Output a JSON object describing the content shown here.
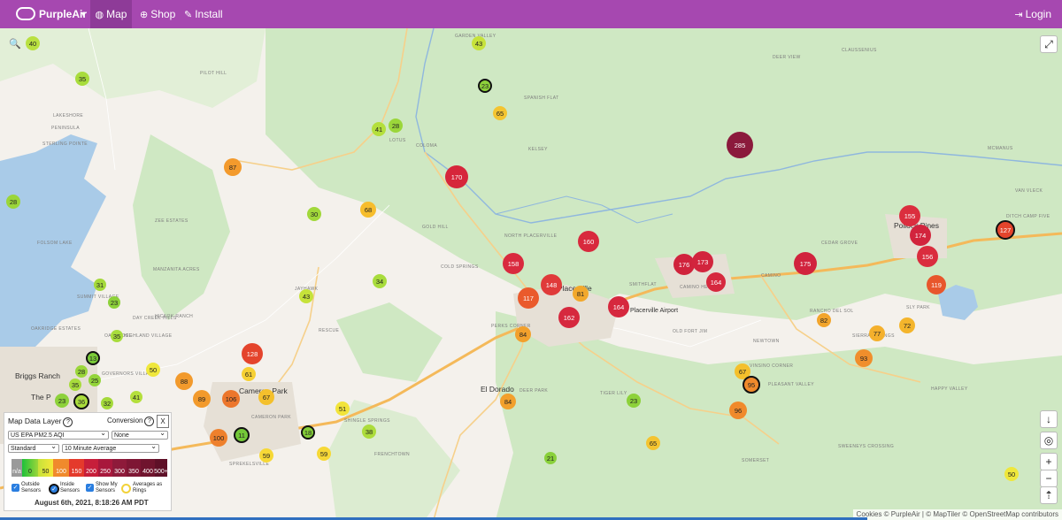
{
  "nav": {
    "brand": "PurpleAir",
    "map": "Map",
    "shop": "Shop",
    "install": "Install",
    "login": "Login"
  },
  "map_labels": [
    {
      "text": "GARDEN VALLEY"
    },
    {
      "text": "PILOT HILL"
    },
    {
      "text": "DEER VIEW"
    },
    {
      "text": "CLAUSSENIUS"
    },
    {
      "text": "SPANISH FLAT"
    },
    {
      "text": "LAKESHORE"
    },
    {
      "text": "PENINSULA"
    },
    {
      "text": "STERLING POINTE"
    },
    {
      "text": "LOTUS"
    },
    {
      "text": "COLOMA"
    },
    {
      "text": "KELSEY"
    },
    {
      "text": "MCMANUS"
    },
    {
      "text": "VAN VLECK"
    },
    {
      "text": "ZEE ESTATES"
    },
    {
      "text": "GOLD HILL"
    },
    {
      "text": "NORTH PLACERVILLE"
    },
    {
      "text": "DITCH CAMP FIVE"
    },
    {
      "text": "CEDAR GROVE"
    },
    {
      "text": "COLD SPRINGS"
    },
    {
      "text": "SMITHFLAT"
    },
    {
      "text": "CAMINO HEIGHTS"
    },
    {
      "text": "CAMINO"
    },
    {
      "text": "MANZANITA ACRES"
    },
    {
      "text": "SUMMIT VILLAGE"
    },
    {
      "text": "JAYHAWK"
    },
    {
      "text": "DAY CREEK HILLS"
    },
    {
      "text": "HICKOK RANCH"
    },
    {
      "text": "RANCHO DEL SOL"
    },
    {
      "text": "SLY PARK"
    },
    {
      "text": "OAK RIDGE"
    },
    {
      "text": "OAKRIDGE ESTATES"
    },
    {
      "text": "RESCUE"
    },
    {
      "text": "PERKS CORNER"
    },
    {
      "text": "OLD FORT JIM"
    },
    {
      "text": "NEWTOWN"
    },
    {
      "text": "SIERRA SPRINGS"
    },
    {
      "text": "GOVERNORS VILLAGE"
    },
    {
      "text": "VINSINO CORNER"
    },
    {
      "text": "DEER PARK"
    },
    {
      "text": "TIGER LILY"
    },
    {
      "text": "PLEASANT VALLEY"
    },
    {
      "text": "HAPPY VALLEY"
    },
    {
      "text": "CAMERON PARK"
    },
    {
      "text": "SHINGLE SPRINGS"
    },
    {
      "text": "SOMERSET"
    },
    {
      "text": "SWEENEYS CROSSING"
    },
    {
      "text": "FRENCHTOWN"
    },
    {
      "text": "SPREKELSVILLE"
    },
    {
      "text": "FOLSOM LAKE"
    },
    {
      "text": "HIGHLAND VILLAGE"
    }
  ],
  "towns": {
    "briggs": "Briggs Ranch",
    "cameron": "Cameron Park",
    "placerville": "Placerville",
    "eldorado": "El Dorado",
    "pollock": "Pollock Pines",
    "airport": "Placerville Airport",
    "thep": "The P"
  },
  "markers": [
    {
      "v": "40",
      "c": "#b9e040"
    },
    {
      "v": "35",
      "c": "#a8dc3c"
    },
    {
      "v": "43",
      "c": "#c6e23a"
    },
    {
      "v": "23",
      "c": "#8dd13a",
      "ring": true
    },
    {
      "v": "65",
      "c": "#f4c430"
    },
    {
      "v": "41",
      "c": "#b4df3c"
    },
    {
      "v": "28",
      "c": "#9bd63a"
    },
    {
      "v": "285",
      "c": "#8b1a3c"
    },
    {
      "v": "87",
      "c": "#f39a2c"
    },
    {
      "v": "170",
      "c": "#d6263b"
    },
    {
      "v": "28",
      "c": "#9bd63a"
    },
    {
      "v": "30",
      "c": "#a1d83a"
    },
    {
      "v": "68",
      "c": "#f6bd2c"
    },
    {
      "v": "155",
      "c": "#db2e3e"
    },
    {
      "v": "174",
      "c": "#d2243d"
    },
    {
      "v": "127",
      "c": "#e4442c",
      "ring": true
    },
    {
      "v": "156",
      "c": "#da2c3e"
    },
    {
      "v": "160",
      "c": "#d8293d"
    },
    {
      "v": "158",
      "c": "#d92a3e"
    },
    {
      "v": "176",
      "c": "#d0233c"
    },
    {
      "v": "173",
      "c": "#d2243d"
    },
    {
      "v": "175",
      "c": "#d1233d"
    },
    {
      "v": "164",
      "c": "#d6283e"
    },
    {
      "v": "31",
      "c": "#a4d93a"
    },
    {
      "v": "34",
      "c": "#a8dc3c"
    },
    {
      "v": "148",
      "c": "#e03a3a"
    },
    {
      "v": "117",
      "c": "#ea5a2c"
    },
    {
      "v": "81",
      "c": "#f2a82c"
    },
    {
      "v": "119",
      "c": "#e8562c"
    },
    {
      "v": "23",
      "c": "#8dd13a"
    },
    {
      "v": "43",
      "c": "#c6e23a"
    },
    {
      "v": "162",
      "c": "#d6283e"
    },
    {
      "v": "164",
      "c": "#d6283e"
    },
    {
      "v": "82",
      "c": "#f2a52c"
    },
    {
      "v": "72",
      "c": "#f4b52c"
    },
    {
      "v": "35",
      "c": "#a8dc3c"
    },
    {
      "v": "84",
      "c": "#f2a02c"
    },
    {
      "v": "77",
      "c": "#f4b02c"
    },
    {
      "v": "93",
      "c": "#f08e2c"
    },
    {
      "v": "13",
      "c": "#7acb38",
      "ring": true
    },
    {
      "v": "28",
      "c": "#9bd63a"
    },
    {
      "v": "50",
      "c": "#efe73c"
    },
    {
      "v": "128",
      "c": "#e4442c"
    },
    {
      "v": "25",
      "c": "#93d43a"
    },
    {
      "v": "35",
      "c": "#a8dc3c"
    },
    {
      "v": "88",
      "c": "#f29a2c"
    },
    {
      "v": "61",
      "c": "#f6d034"
    },
    {
      "v": "67",
      "c": "#f4c02c"
    },
    {
      "v": "95",
      "c": "#f08a2c",
      "ring": true
    },
    {
      "v": "41",
      "c": "#b4df3c"
    },
    {
      "v": "23",
      "c": "#8dd13a"
    },
    {
      "v": "36",
      "c": "#aadc3c",
      "ring": true
    },
    {
      "v": "32",
      "c": "#a4d93a"
    },
    {
      "v": "89",
      "c": "#f29a2c"
    },
    {
      "v": "106",
      "c": "#ec762c"
    },
    {
      "v": "67",
      "c": "#f4c02c"
    },
    {
      "v": "51",
      "c": "#f2e43a"
    },
    {
      "v": "84",
      "c": "#f2a02c"
    },
    {
      "v": "23",
      "c": "#8dd13a"
    },
    {
      "v": "96",
      "c": "#f08a2c"
    },
    {
      "v": "100",
      "c": "#ee802c"
    },
    {
      "v": "11",
      "c": "#74c838",
      "ring": true
    },
    {
      "v": "18",
      "c": "#84ce38",
      "ring": true
    },
    {
      "v": "38",
      "c": "#acdc3c"
    },
    {
      "v": "59",
      "c": "#f6d836"
    },
    {
      "v": "59",
      "c": "#f6d836"
    },
    {
      "v": "65",
      "c": "#f4c430"
    },
    {
      "v": "21",
      "c": "#89d03a"
    },
    {
      "v": "50",
      "c": "#efe73c"
    }
  ],
  "panel": {
    "title": "Map Data Layer",
    "conversion": "Conversion",
    "layer_select": "US EPA PM2.5 AQI",
    "conversion_select": "None",
    "mode_select": "Standard",
    "avg_select": "10 Minute Average",
    "legend": [
      {
        "label": "n/a",
        "c": "#9a9a9a"
      },
      {
        "label": "0",
        "c": "#1ec03a"
      },
      {
        "label": "50",
        "c": "#f6e83a"
      },
      {
        "label": "100",
        "c": "#f08a2c"
      },
      {
        "label": "150",
        "c": "#e43a2c"
      },
      {
        "label": "200",
        "c": "#c71e3a"
      },
      {
        "label": "250",
        "c": "#a8183c"
      },
      {
        "label": "300",
        "c": "#8e1a3a"
      },
      {
        "label": "350",
        "c": "#7e1634"
      },
      {
        "label": "400",
        "c": "#70142e"
      },
      {
        "label": "500+",
        "c": "#5e1028"
      }
    ],
    "cb_outside": "Outside Sensors",
    "cb_inside": "Inside Sensors",
    "cb_mine": "Show My Sensors",
    "cb_rings": "Averages as Rings",
    "timestamp": "August 6th, 2021, 8:18:26 AM PDT",
    "close": "X",
    "q": "?"
  },
  "attribution": "Cookies © PurpleAir | © MapTiler © OpenStreetMap contributors",
  "controls": {
    "fullscreen": "⤢",
    "arrow": "↓",
    "locate": "◎",
    "zoom_in": "+",
    "zoom_out": "−",
    "north": "⇡",
    "search": "🔍"
  },
  "colors": {
    "nav": "#a648b0",
    "nav_active": "#8e3b98",
    "water": "#a9cbe8",
    "green": "#cfe8c3"
  }
}
